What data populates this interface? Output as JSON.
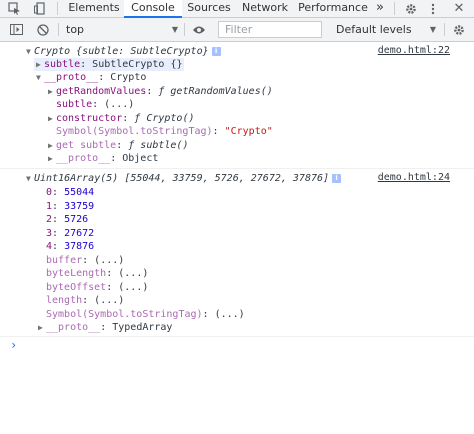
{
  "tabs": [
    {
      "label": "Elements"
    },
    {
      "label": "Console"
    },
    {
      "label": "Sources"
    },
    {
      "label": "Network"
    },
    {
      "label": "Performance"
    }
  ],
  "more_tabs_label": "»",
  "toolbar": {
    "context": "top",
    "filter_placeholder": "Filter",
    "levels": "Default levels"
  },
  "log1": {
    "header_name": "Crypto",
    "header_preview": "{subtle: SubtleCrypto}",
    "source": "demo.html:22",
    "subtle_key": "subtle",
    "subtle_val": "SubtleCrypto {}",
    "proto_key": "__proto__",
    "proto_val": "Crypto",
    "getRandomValues_key": "getRandomValues",
    "getRandomValues_val": "ƒ getRandomValues()",
    "subtle2_key": "subtle",
    "subtle2_val": "(...)",
    "constructor_key": "constructor",
    "constructor_val": "ƒ Crypto()",
    "symbol_key": "Symbol(Symbol.toStringTag)",
    "symbol_val": "\"Crypto\"",
    "getsubtle_key": "get subtle",
    "getsubtle_val": "ƒ subtle()",
    "proto2_key": "__proto__",
    "proto2_val": "Object"
  },
  "log2": {
    "header_name": "Uint16Array(5)",
    "header_preview": "[55044, 33759, 5726, 27672, 37876]",
    "source": "demo.html:24",
    "items": [
      {
        "key": "0",
        "val": "55044"
      },
      {
        "key": "1",
        "val": "33759"
      },
      {
        "key": "2",
        "val": "5726"
      },
      {
        "key": "3",
        "val": "27672"
      },
      {
        "key": "4",
        "val": "37876"
      }
    ],
    "buffer_key": "buffer",
    "bytelength_key": "byteLength",
    "byteoffset_key": "byteOffset",
    "length_key": "length",
    "symbol_key": "Symbol(Symbol.toStringTag)",
    "lazy_val": "(...)",
    "proto_key": "__proto__",
    "proto_val": "TypedArray"
  },
  "prompt_symbol": "›"
}
